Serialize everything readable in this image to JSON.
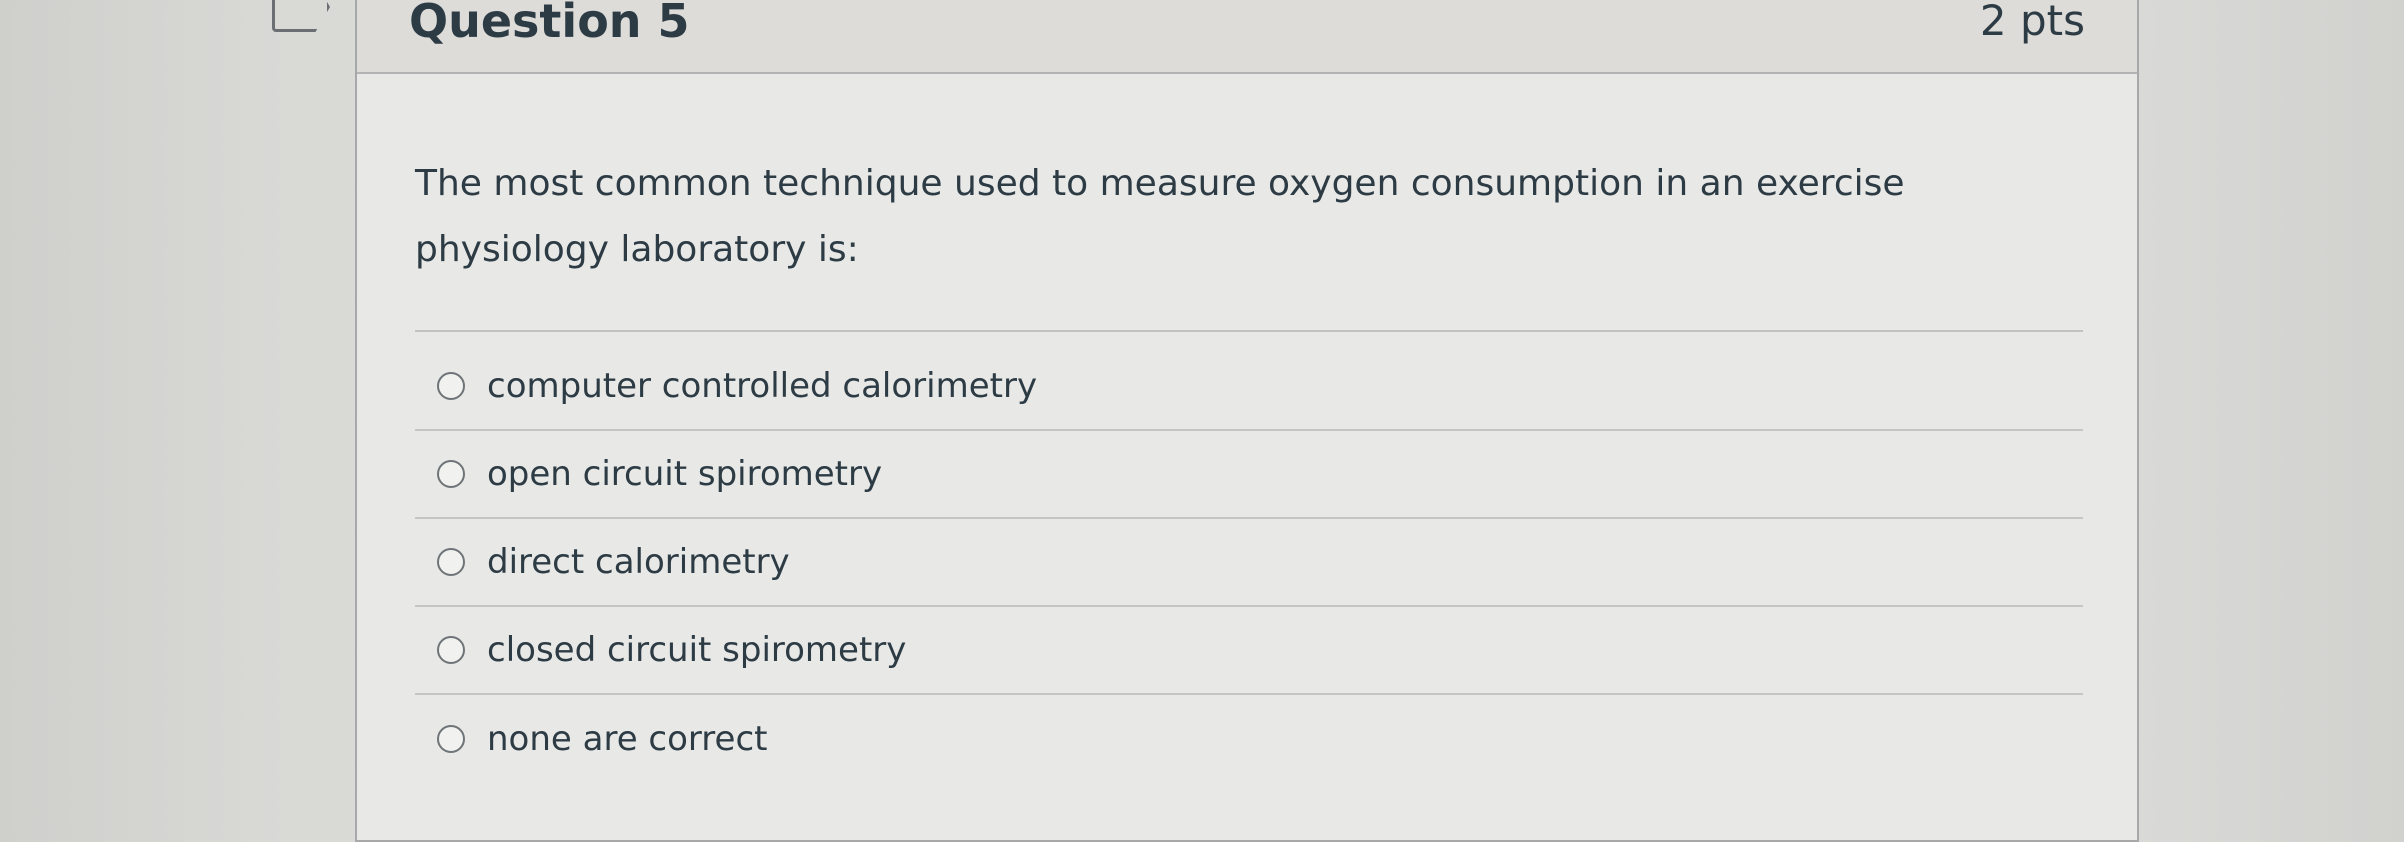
{
  "question": {
    "title": "Question 5",
    "points": "2 pts",
    "text": "The most common technique used to measure oxygen consumption in an exercise physiology laboratory is:",
    "answers": [
      {
        "label": "computer controlled calorimetry"
      },
      {
        "label": "open circuit spirometry"
      },
      {
        "label": "direct calorimetry"
      },
      {
        "label": "closed circuit spirometry"
      },
      {
        "label": "none are correct"
      }
    ]
  },
  "colors": {
    "text": "#2d3b45",
    "card_background": "#e8e8e6",
    "header_background": "#dddcd9",
    "divider": "#c4c5c5"
  },
  "icons": {
    "flag": "flag-icon",
    "radio": "radio-button-unchecked"
  }
}
